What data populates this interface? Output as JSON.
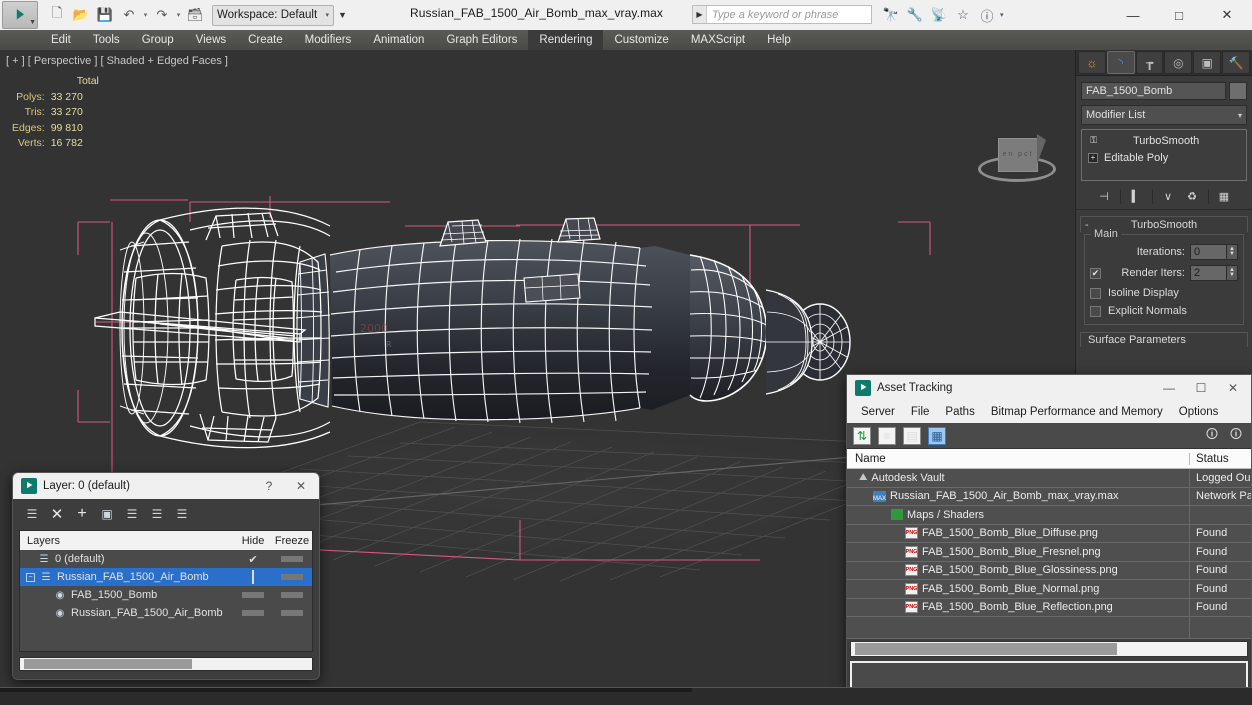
{
  "app": {
    "title": "Russian_FAB_1500_Air_Bomb_max_vray.max",
    "logo_glyph": "▶"
  },
  "quick_access": {
    "buttons": [
      {
        "name": "new-file",
        "glyph": "⬜"
      },
      {
        "name": "open-file",
        "glyph": "📂"
      },
      {
        "name": "save-file",
        "glyph": "💾"
      },
      {
        "name": "undo",
        "glyph": "↶"
      },
      {
        "name": "undo-dropdown",
        "glyph": "▾"
      },
      {
        "name": "redo",
        "glyph": "↷"
      },
      {
        "name": "redo-dropdown",
        "glyph": "▾"
      },
      {
        "name": "set-project-folder",
        "glyph": "🖿"
      }
    ],
    "workspace_label": "Workspace: Default",
    "workspace_caret": "▾",
    "workspace_dropdown": "▼"
  },
  "search": {
    "arrow": "▶",
    "placeholder": "Type a keyword or phrase"
  },
  "title_icons": [
    {
      "name": "binoculars-icon",
      "glyph": "🔭"
    },
    {
      "name": "wrench-icon",
      "glyph": "🔧"
    },
    {
      "name": "satellite-icon",
      "glyph": "📡"
    },
    {
      "name": "star-icon",
      "glyph": "☆"
    },
    {
      "name": "help-icon",
      "glyph": "ⓘ"
    },
    {
      "name": "help-caret-icon",
      "glyph": "▾"
    }
  ],
  "window_buttons": {
    "minimize": "—",
    "maximize": "☐",
    "close": "✕"
  },
  "menu": {
    "items": [
      {
        "label": "Edit",
        "highlight": false
      },
      {
        "label": "Tools",
        "highlight": false
      },
      {
        "label": "Group",
        "highlight": false
      },
      {
        "label": "Views",
        "highlight": false
      },
      {
        "label": "Create",
        "highlight": false
      },
      {
        "label": "Modifiers",
        "highlight": false
      },
      {
        "label": "Animation",
        "highlight": false
      },
      {
        "label": "Graph Editors",
        "highlight": false
      },
      {
        "label": "Rendering",
        "highlight": true
      },
      {
        "label": "Customize",
        "highlight": false
      },
      {
        "label": "MAXScript",
        "highlight": false
      },
      {
        "label": "Help",
        "highlight": false
      }
    ]
  },
  "viewport": {
    "label": "[ + ] [ Perspective ] [ Shaded + Edged Faces ]",
    "stats_header": "Total",
    "stats": [
      {
        "label": "Polys:",
        "value": "33 270"
      },
      {
        "label": "Tris:",
        "value": "33 270"
      },
      {
        "label": "Edges:",
        "value": "99 810"
      },
      {
        "label": "Verts:",
        "value": "16 782"
      }
    ],
    "viewcube_faces": "en     pct",
    "selection_color": "#d9577f"
  },
  "command_panel": {
    "tabs": [
      {
        "name": "create-tab",
        "glyph": "☀"
      },
      {
        "name": "modify-tab",
        "glyph": "◜"
      },
      {
        "name": "hierarchy-tab",
        "glyph": "⑂"
      },
      {
        "name": "motion-tab",
        "glyph": "◎"
      },
      {
        "name": "display-tab",
        "glyph": "▣"
      },
      {
        "name": "utilities-tab",
        "glyph": "🔨"
      }
    ],
    "object_name": "FAB_1500_Bomb",
    "modifier_list_label": "Modifier List",
    "modifier_list_caret": "⌄",
    "stack": [
      {
        "label": "TurboSmooth",
        "icon": "bulb-icon",
        "glyph": "⚬"
      },
      {
        "label": "Editable Poly",
        "icon": "plus-box-icon",
        "glyph": "+"
      }
    ],
    "stack_tools": [
      {
        "name": "pin-stack-icon",
        "glyph": "⊣"
      },
      {
        "name": "show-end-result-icon",
        "glyph": "▍"
      },
      {
        "name": "make-unique-icon",
        "glyph": "✔"
      },
      {
        "name": "remove-modifier-icon",
        "glyph": "🗑"
      },
      {
        "name": "configure-modifier-sets-icon",
        "glyph": "▦"
      }
    ],
    "rollout": {
      "title": "TurboSmooth",
      "collapse_glyph": "-",
      "group_title": "Main",
      "iterations_label": "Iterations:",
      "iterations_value": "0",
      "render_iters_label": "Render Iters:",
      "render_iters_value": "2",
      "render_iters_checked": "✔",
      "isoline_display_label": "Isoline Display",
      "explicit_normals_label": "Explicit Normals"
    },
    "surface_parameters_label": "Surface Parameters"
  },
  "layer_dialog": {
    "title": "Layer: 0 (default)",
    "help_glyph": "?",
    "close_glyph": "✕",
    "toolbar": [
      {
        "name": "new-layer-icon",
        "glyph": "≣"
      },
      {
        "name": "delete-layer-icon",
        "glyph": "✕"
      },
      {
        "name": "add-layer-icon",
        "glyph": "+"
      },
      {
        "name": "select-objects-in-layer-icon",
        "glyph": "▣"
      },
      {
        "name": "add-selection-to-layer-icon",
        "glyph": "≣"
      },
      {
        "name": "select-highlighted-layer-icon",
        "glyph": "≣"
      },
      {
        "name": "set-current-layer-icon",
        "glyph": "≣"
      }
    ],
    "columns": {
      "name": "Layers",
      "hide": "Hide",
      "freeze": "Freeze"
    },
    "rows": [
      {
        "label": "0 (default)",
        "indent": 0,
        "selected": false,
        "current": "✔",
        "has_box": false,
        "expandable": false
      },
      {
        "label": "Russian_FAB_1500_Air_Bomb",
        "indent": 1,
        "selected": true,
        "current": "",
        "has_box": true,
        "expandable": true
      },
      {
        "label": "FAB_1500_Bomb",
        "indent": 2,
        "selected": false,
        "current": "",
        "has_box": false,
        "expandable": false
      },
      {
        "label": "Russian_FAB_1500_Air_Bomb",
        "indent": 2,
        "selected": false,
        "current": "",
        "has_box": false,
        "expandable": false
      }
    ]
  },
  "asset_dialog": {
    "title": "Asset Tracking",
    "window_buttons": {
      "minimize": "—",
      "maximize": "☐",
      "close": "✕"
    },
    "menu": [
      "Server",
      "File",
      "Paths",
      "Bitmap Performance and Memory",
      "Options"
    ],
    "toolbar": [
      {
        "name": "refresh-icon",
        "glyph": "↻",
        "active": false,
        "green": true
      },
      {
        "name": "list-view-icon",
        "glyph": "≡",
        "active": false,
        "green": false
      },
      {
        "name": "bitmap-view-icon",
        "glyph": "▤",
        "active": false,
        "green": false
      },
      {
        "name": "grid-view-icon",
        "glyph": "▦",
        "active": true,
        "green": false
      }
    ],
    "toolbar_right": [
      {
        "name": "help-icon",
        "glyph": "?"
      },
      {
        "name": "help-alt-icon",
        "glyph": "?"
      }
    ],
    "columns": {
      "name": "Name",
      "status": "Status"
    },
    "rows": [
      {
        "label": "Autodesk Vault",
        "status": "Logged Ou",
        "indent": 0,
        "icon": "vault-icon"
      },
      {
        "label": "Russian_FAB_1500_Air_Bomb_max_vray.max",
        "status": "Network Pа",
        "indent": 1,
        "icon": "max-file-icon"
      },
      {
        "label": "Maps / Shaders",
        "status": "",
        "indent": 2,
        "icon": "maps-icon"
      },
      {
        "label": "FAB_1500_Bomb_Blue_Diffuse.png",
        "status": "Found",
        "indent": 3,
        "icon": "png-icon"
      },
      {
        "label": "FAB_1500_Bomb_Blue_Fresnel.png",
        "status": "Found",
        "indent": 3,
        "icon": "png-icon"
      },
      {
        "label": "FAB_1500_Bomb_Blue_Glossiness.png",
        "status": "Found",
        "indent": 3,
        "icon": "png-icon"
      },
      {
        "label": "FAB_1500_Bomb_Blue_Normal.png",
        "status": "Found",
        "indent": 3,
        "icon": "png-icon"
      },
      {
        "label": "FAB_1500_Bomb_Blue_Reflection.png",
        "status": "Found",
        "indent": 3,
        "icon": "png-icon"
      }
    ]
  }
}
